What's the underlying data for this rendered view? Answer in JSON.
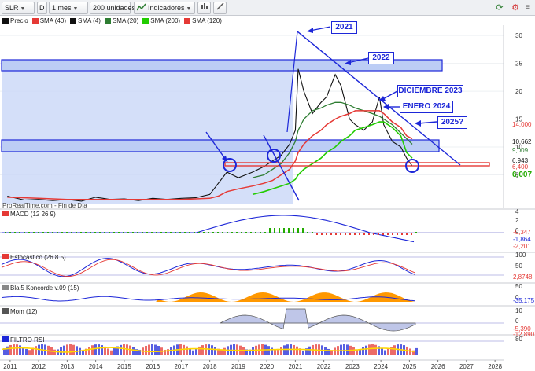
{
  "toolbar": {
    "symbol": "SLR",
    "d_label": "D",
    "period": "1 mes",
    "units": "200 unidades",
    "indicators_label": "Indicadores"
  },
  "legend": [
    "Precio",
    "SMA (40)",
    "SMA (4)",
    "SMA (20)",
    "SMA (200)",
    "SMA (120)"
  ],
  "colors": {
    "price": "#111111",
    "sma40": "#e53935",
    "sma4": "#111111",
    "sma20": "#2e7d32",
    "sma200": "#22cc00",
    "sma120": "#e53935",
    "annotation": "#1d27d8",
    "box_fill": "#c9d7f7"
  },
  "annotations": {
    "y2021": "2021",
    "y2022": "2022",
    "dic2023": "DICIEMBRE 2023",
    "ene2024": "ENERO 2024",
    "y2025": "2025?"
  },
  "watermark": "ProRealTime.com - Fin de Día",
  "main_ticks": [
    "30",
    "25",
    "20",
    "15",
    "10",
    "5"
  ],
  "price_labels": {
    "lbl1": "14,000",
    "lbl2": "10,662",
    "lbl3": "9,009",
    "lbl4": "6,943",
    "lbl5": "6,400",
    "lbl6": "6,007"
  },
  "panels": {
    "macd": {
      "name": "MACD (12 26 9)",
      "ticks": [
        "4",
        "2",
        "0"
      ],
      "v1": "-0,347",
      "v2": "-1,864",
      "v3": "-2,201"
    },
    "stoch": {
      "name": "Estocástico (26 8 5)",
      "ticks": [
        "100",
        "50"
      ],
      "v1": "2,8748"
    },
    "blai": {
      "name": "Blai5 Koncorde v.09 (15)",
      "ticks": [
        "50",
        "0"
      ],
      "v1": "-35,175"
    },
    "mom": {
      "name": "Mom (12)",
      "ticks": [
        "10",
        "0"
      ],
      "v1": "-5,390",
      "v2": "-12,890"
    },
    "rsi": {
      "name": "FILTRO RSI",
      "ticks": [
        "80"
      ]
    }
  },
  "x_axis": [
    "2011",
    "2012",
    "2013",
    "2014",
    "2015",
    "2016",
    "2017",
    "2018",
    "2019",
    "2020",
    "2021",
    "2022",
    "2023",
    "2024",
    "2025",
    "2026",
    "2027",
    "2028"
  ],
  "chart_data": {
    "type": "line",
    "x": [
      2010.9,
      2011.5,
      2012.0,
      2012.5,
      2013.0,
      2013.5,
      2014.0,
      2014.5,
      2015.0,
      2015.5,
      2016.0,
      2016.5,
      2017.0,
      2017.5,
      2018.0,
      2018.3,
      2018.6,
      2019.0,
      2019.5,
      2019.9,
      2020.2,
      2020.5,
      2020.8,
      2021.0,
      2021.1,
      2021.3,
      2021.6,
      2021.9,
      2022.1,
      2022.4,
      2022.6,
      2022.9,
      2023.1,
      2023.4,
      2023.7,
      2023.95,
      2024.1,
      2024.4,
      2024.7,
      2024.9,
      2025.1
    ],
    "series": [
      {
        "name": "Precio",
        "values": [
          1.2,
          0.5,
          0.6,
          0.4,
          0.6,
          0.3,
          1.0,
          0.6,
          0.7,
          0.4,
          0.8,
          0.6,
          0.8,
          0.9,
          1.5,
          3.5,
          5.5,
          4.5,
          5.5,
          6.5,
          7.5,
          8.5,
          10.5,
          13.0,
          24.0,
          20.0,
          16.0,
          18.0,
          19.0,
          23.0,
          21.0,
          15.0,
          14.0,
          13.0,
          14.5,
          19.0,
          14.0,
          11.0,
          10.0,
          8.0,
          6.6
        ]
      },
      {
        "name": "SMA (20)",
        "values": [
          null,
          null,
          null,
          null,
          null,
          null,
          null,
          null,
          null,
          null,
          null,
          null,
          null,
          null,
          null,
          null,
          null,
          null,
          4.5,
          5.0,
          6.0,
          7.0,
          9.0,
          11.0,
          13.0,
          15.0,
          16.5,
          17.0,
          17.5,
          18.0,
          18.0,
          17.5,
          17.0,
          16.5,
          16.0,
          15.5,
          15.0,
          14.0,
          12.5,
          11.5,
          10.5
        ]
      },
      {
        "name": "SMA (200)",
        "values": [
          null,
          null,
          null,
          null,
          null,
          null,
          null,
          null,
          null,
          null,
          null,
          null,
          null,
          null,
          null,
          null,
          null,
          null,
          1.5,
          2.0,
          2.5,
          3.0,
          3.5,
          4.2,
          5.0,
          6.0,
          7.0,
          8.0,
          9.0,
          10.0,
          11.0,
          12.0,
          13.0,
          13.5,
          14.0,
          14.5,
          14.5,
          13.5,
          12.0,
          9.0,
          8.0
        ]
      },
      {
        "name": "SMA (40)",
        "values": [
          1.0,
          0.9,
          0.8,
          0.7,
          0.6,
          0.6,
          0.6,
          0.6,
          0.6,
          0.6,
          0.6,
          0.6,
          0.6,
          0.7,
          0.8,
          1.2,
          2.0,
          2.5,
          3.0,
          3.5,
          4.0,
          5.0,
          6.0,
          7.5,
          9.0,
          10.5,
          12.0,
          13.0,
          14.0,
          15.0,
          15.5,
          16.0,
          16.5,
          16.5,
          16.5,
          16.5,
          16.0,
          14.5,
          13.5,
          12.0,
          11.5
        ]
      }
    ],
    "ylim": [
      0,
      31
    ],
    "xlim": [
      2010.7,
      2028.3
    ]
  }
}
